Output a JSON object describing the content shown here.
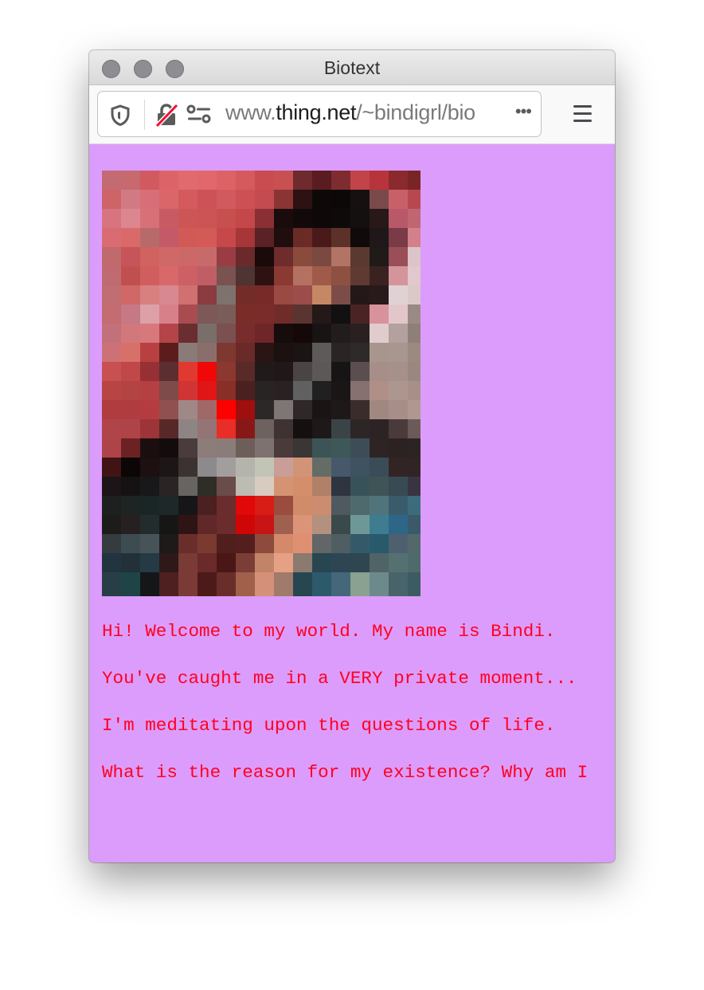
{
  "window": {
    "title": "Biotext",
    "traffic_lights": [
      "close",
      "minimize",
      "zoom"
    ]
  },
  "toolbar": {
    "icons": [
      "tracking-protection-shield-icon",
      "insecure-lock-icon",
      "permissions-icon"
    ],
    "url_prefix": "www.",
    "url_host": "thing.net",
    "url_path": "/~bindigrl/bio",
    "page_actions_label": "•••",
    "menu_icon": "hamburger-menu-icon"
  },
  "page": {
    "background_color": "#dc9cfb",
    "text_color": "#ff0022",
    "image_alt": "pixelated photo of Bindi",
    "paragraphs": [
      "Hi! Welcome to my world. My name is Bindi.",
      "You've caught me in a VERY private moment...",
      "I'm meditating upon the questions of life.",
      "What is the reason for my existence? Why am I"
    ]
  },
  "photo_pixels": [
    [
      "#c46a72",
      "#c66a70",
      "#d05a5f",
      "#dc6468",
      "#e06a6e",
      "#e2676c",
      "#dc6266",
      "#d45a5e",
      "#c84c50",
      "#c85050",
      "#6e2a2c",
      "#5a1c20",
      "#7e2c30",
      "#c24448",
      "#b8343c",
      "#8a2a2e",
      "#7a2428"
    ],
    [
      "#cc6468",
      "#d27a84",
      "#d86e78",
      "#da666a",
      "#d45a5e",
      "#cc5258",
      "#d05a5e",
      "#cc5054",
      "#c44c50",
      "#8a3434",
      "#2c1212",
      "#0e0808",
      "#0c0808",
      "#161010",
      "#7a4a4a",
      "#c8606a",
      "#b84850"
    ],
    [
      "#d87480",
      "#dc8690",
      "#d87078",
      "#c85a64",
      "#cc5656",
      "#cc5454",
      "#c6504e",
      "#c4484a",
      "#8a3034",
      "#1a0c0c",
      "#120a0a",
      "#0e0808",
      "#0e0a0a",
      "#141010",
      "#281818",
      "#b85868",
      "#c06670"
    ],
    [
      "#d86c72",
      "#da6a6a",
      "#b86a6a",
      "#c45a68",
      "#d25a56",
      "#d45a58",
      "#c6484a",
      "#a63638",
      "#5a2224",
      "#200e0e",
      "#6a2a26",
      "#4a1a1a",
      "#5c3228",
      "#100a0a",
      "#201818",
      "#7a3a48",
      "#d4808a"
    ],
    [
      "#c06a6e",
      "#c65458",
      "#d06260",
      "#d06868",
      "#cc6868",
      "#c86a6a",
      "#9a3c44",
      "#6a2a2c",
      "#1a0a0a",
      "#6e2c2c",
      "#8a4a3c",
      "#7a4a40",
      "#b27464",
      "#5a3a30",
      "#201a18",
      "#9a4e58",
      "#dcc4c8"
    ],
    [
      "#c06a72",
      "#c05050",
      "#d05e5e",
      "#d8686a",
      "#cc6064",
      "#c05e66",
      "#7a5250",
      "#4e3432",
      "#2e1212",
      "#8a3a32",
      "#b47060",
      "#a05a4a",
      "#8e5040",
      "#5e3a32",
      "#3a2220",
      "#d4949c",
      "#e0c8cc"
    ],
    [
      "#c06e72",
      "#d06868",
      "#d88080",
      "#d88890",
      "#d07070",
      "#8a3c40",
      "#7e726e",
      "#742c28",
      "#782a28",
      "#9a4a42",
      "#9c4c4a",
      "#c48864",
      "#7c4c48",
      "#241818",
      "#281a1a",
      "#e0d2d4",
      "#ddc8c8"
    ],
    [
      "#c46c70",
      "#c67884",
      "#dca0a6",
      "#d8808a",
      "#a84c50",
      "#7c5858",
      "#7a5c58",
      "#7a2c28",
      "#7a2c2a",
      "#702c28",
      "#5a3430",
      "#241818",
      "#121010",
      "#4a2424",
      "#d8929c",
      "#e2c6ca",
      "#9a8a84"
    ],
    [
      "#c2707a",
      "#d2787c",
      "#d8787c",
      "#b44448",
      "#6a2e30",
      "#7a6e6a",
      "#7a5050",
      "#782c2c",
      "#6e2626",
      "#160c0c",
      "#140808",
      "#181414",
      "#221c1c",
      "#2a2020",
      "#e0cccc",
      "#b4a09c",
      "#8e8078"
    ],
    [
      "#cc7276",
      "#d8706a",
      "#b84040",
      "#5c1c1c",
      "#8a7a78",
      "#8a6e6c",
      "#7e3830",
      "#6a2a28",
      "#2a1414",
      "#1c1010",
      "#1a1414",
      "#5e5a58",
      "#2a2424",
      "#2e2a2a",
      "#a8968e",
      "#a89690",
      "#9a8a80"
    ],
    [
      "#c85050",
      "#c04848",
      "#963034",
      "#5c2e30",
      "#e03a30",
      "#f00808",
      "#8a3830",
      "#5a2a28",
      "#201a1a",
      "#201818",
      "#4a4444",
      "#5c5858",
      "#161414",
      "#5a4e4e",
      "#a88e88",
      "#a8908a",
      "#9a8880"
    ],
    [
      "#b84444",
      "#b44444",
      "#b44044",
      "#7e4a4a",
      "#d03434",
      "#e01616",
      "#8a2e28",
      "#4a2020",
      "#282424",
      "#2a2222",
      "#606060",
      "#202020",
      "#1a1616",
      "#867070",
      "#b09086",
      "#ae9690",
      "#a89088"
    ],
    [
      "#b03c40",
      "#b03c40",
      "#b43c40",
      "#905050",
      "#a08886",
      "#a06868",
      "#ff0000",
      "#a00e0e",
      "#2c2828",
      "#7e7674",
      "#302828",
      "#1a1414",
      "#1e1818",
      "#3a2c2a",
      "#a08880",
      "#a88e88",
      "#b09890"
    ],
    [
      "#b04448",
      "#ae4448",
      "#9c3438",
      "#582828",
      "#8e8484",
      "#947474",
      "#e82e26",
      "#881818",
      "#6e6260",
      "#3e3232",
      "#141010",
      "#1e1818",
      "#3a4446",
      "#2c2626",
      "#2c2424",
      "#4a3a3a",
      "#6c5a58"
    ],
    [
      "#ae4448",
      "#6c2222",
      "#1c0e0e",
      "#140c0c",
      "#4a3c3c",
      "#8c7c7a",
      "#8a7c78",
      "#6e5e5a",
      "#7e7270",
      "#4a3a3a",
      "#3a3636",
      "#3c5456",
      "#3e5858",
      "#3e4c58",
      "#2e2424",
      "#2c2222",
      "#2c2424"
    ],
    [
      "#401414",
      "#0c0606",
      "#1c1010",
      "#1c1616",
      "#3c3232",
      "#8c8a8c",
      "#a29e9e",
      "#b4b4ac",
      "#c2c4b6",
      "#c89e96",
      "#d29478",
      "#646c66",
      "#46586a",
      "#3e5260",
      "#3a4c58",
      "#322424",
      "#302424"
    ],
    [
      "#1c1416",
      "#161214",
      "#18181a",
      "#2a2424",
      "#686462",
      "#2e2e26",
      "#6a4c4a",
      "#bcbcb2",
      "#d8ccc0",
      "#d49474",
      "#d48e6a",
      "#b08068",
      "#2e3440",
      "#38525a",
      "#3e5456",
      "#384a54",
      "#3a3440"
    ],
    [
      "#1e2020",
      "#1e2424",
      "#1a2626",
      "#1e2828",
      "#161618",
      "#4a2020",
      "#6a2c2c",
      "#e00808",
      "#d81c16",
      "#9a4c3e",
      "#d08c68",
      "#cc8c70",
      "#4e5a60",
      "#4e6a6c",
      "#50747a",
      "#3a5c6a",
      "#3c6c7c"
    ],
    [
      "#1e1c1a",
      "#262020",
      "#222c2c",
      "#161616",
      "#2e1414",
      "#602828",
      "#6a2c2c",
      "#d00606",
      "#c81414",
      "#a06050",
      "#dc9478",
      "#b4907e",
      "#3a4a4a",
      "#6e9898",
      "#3e7c90",
      "#2e6688",
      "#3a5a6a"
    ],
    [
      "#343c40",
      "#3c4c50",
      "#46545a",
      "#1e1a1a",
      "#6a2e2a",
      "#7a3a30",
      "#501e1c",
      "#541e1e",
      "#8e4a3c",
      "#d48a6a",
      "#e09072",
      "#626666",
      "#4e5e62",
      "#345a6a",
      "#285a6c",
      "#4e6070",
      "#52686a"
    ],
    [
      "#223440",
      "#22303a",
      "#243a44",
      "#2e1818",
      "#7a3a36",
      "#6a2a2a",
      "#4a1616",
      "#7a3e36",
      "#c28468",
      "#e6a084",
      "#8a7a70",
      "#284650",
      "#2e4654",
      "#2e4650",
      "#506466",
      "#547070",
      "#4e6a6a"
    ],
    [
      "#283e46",
      "#1e4448",
      "#141618",
      "#4e2020",
      "#7a3a36",
      "#4c1a18",
      "#6a2e2a",
      "#a0604a",
      "#d49078",
      "#a07a6a",
      "#264650",
      "#2c5a6a",
      "#44687a",
      "#8aa090",
      "#6c8a8c",
      "#48646a",
      "#3c5c64"
    ],
    [
      "#283e46",
      "#1e4448",
      "#141618",
      "#4e2020",
      "#7a3a36",
      "#4c1a18",
      "#6a2e2a",
      "#a0604a",
      "#d49078",
      "#a07a6a",
      "#264650",
      "#2c5a6a",
      "#44687a",
      "#8aa090",
      "#6c8a8c",
      "#48646a",
      "#3c5c64"
    ]
  ]
}
